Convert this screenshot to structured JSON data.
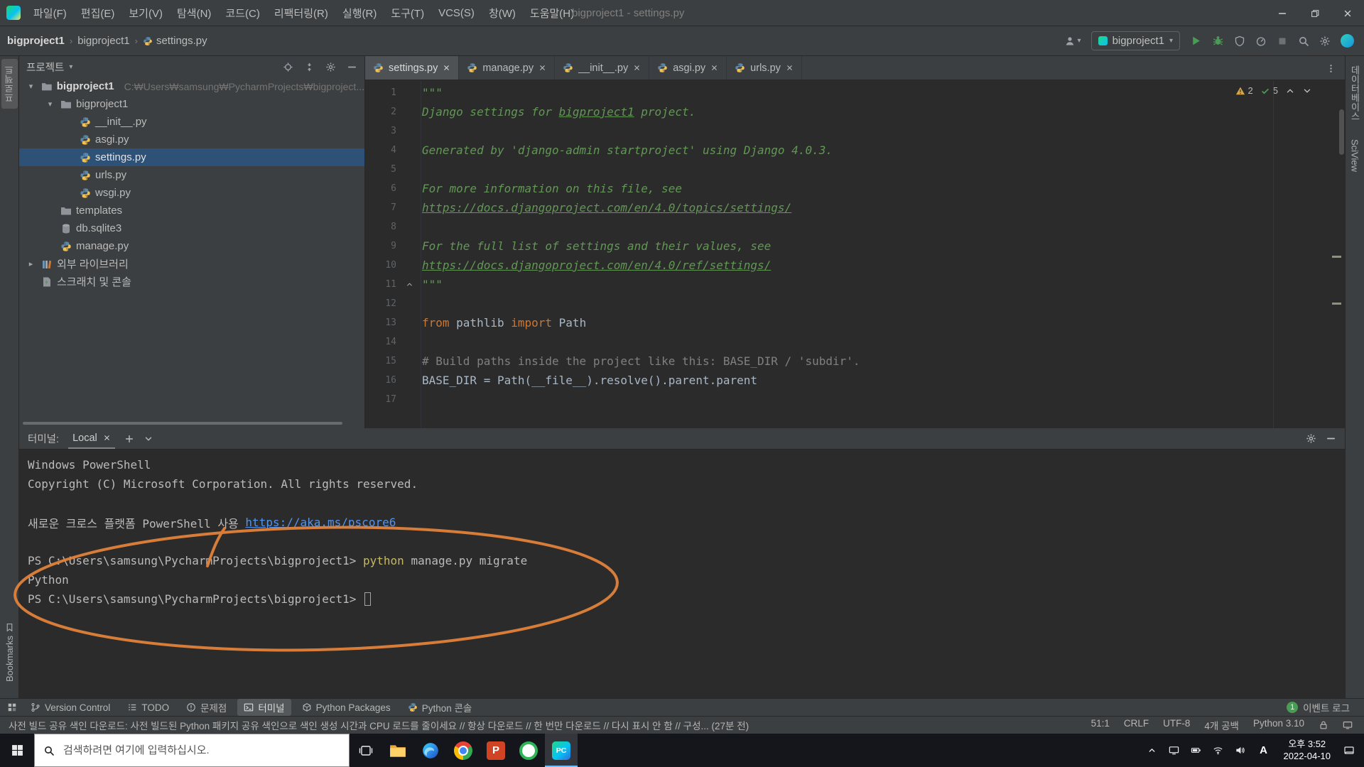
{
  "app": {
    "title": "bigproject1 - settings.py"
  },
  "titlebar": {
    "menus": [
      "파일(F)",
      "편집(E)",
      "보기(V)",
      "탐색(N)",
      "코드(C)",
      "리팩터링(R)",
      "실행(R)",
      "도구(T)",
      "VCS(S)",
      "창(W)",
      "도움말(H)"
    ]
  },
  "navbar": {
    "breadcrumbs": [
      {
        "label": "bigproject1"
      },
      {
        "label": "bigproject1"
      },
      {
        "label": "settings.py",
        "icon": "python"
      }
    ],
    "run_config": {
      "label": "bigproject1"
    }
  },
  "tool_strips": {
    "left_top": [
      {
        "label": "프로젝트",
        "active": true
      }
    ],
    "left_bottom": [
      {
        "label": "Bookmarks"
      }
    ],
    "right": [
      {
        "label": "데이터베이스"
      },
      {
        "label": "SciView"
      }
    ]
  },
  "project_panel": {
    "title": "프로젝트",
    "tree": [
      {
        "indent": 0,
        "chev": "down",
        "icon": "folder",
        "label": "bigproject1",
        "bold": true,
        "hint": "C:₩Users₩samsung₩PycharmProjects₩bigproject..."
      },
      {
        "indent": 1,
        "chev": "down",
        "icon": "folder",
        "label": "bigproject1"
      },
      {
        "indent": 2,
        "icon": "python",
        "label": "__init__.py"
      },
      {
        "indent": 2,
        "icon": "python",
        "label": "asgi.py"
      },
      {
        "indent": 2,
        "icon": "python",
        "label": "settings.py",
        "selected": true
      },
      {
        "indent": 2,
        "icon": "python",
        "label": "urls.py"
      },
      {
        "indent": 2,
        "icon": "python",
        "label": "wsgi.py"
      },
      {
        "indent": 1,
        "icon": "folder",
        "label": "templates"
      },
      {
        "indent": 1,
        "icon": "db",
        "label": "db.sqlite3"
      },
      {
        "indent": 1,
        "icon": "python",
        "label": "manage.py"
      },
      {
        "indent": 0,
        "chev": "right",
        "icon": "libs",
        "label": "외부 라이브러리"
      },
      {
        "indent": 0,
        "icon": "scratch",
        "label": "스크래치 및 콘솔"
      }
    ]
  },
  "editor": {
    "tabs": [
      {
        "label": "settings.py",
        "active": true
      },
      {
        "label": "manage.py"
      },
      {
        "label": "__init__.py"
      },
      {
        "label": "asgi.py"
      },
      {
        "label": "urls.py"
      }
    ],
    "inspections": {
      "warnings": "2",
      "ok": "5"
    },
    "lines": [
      {
        "n": "1",
        "segs": [
          {
            "t": "\"\"\"",
            "c": "doc"
          }
        ]
      },
      {
        "n": "2",
        "segs": [
          {
            "t": "Django settings for ",
            "c": "doc"
          },
          {
            "t": "bigproject1",
            "c": "doc-u"
          },
          {
            "t": " project.",
            "c": "doc"
          }
        ]
      },
      {
        "n": "3",
        "segs": []
      },
      {
        "n": "4",
        "segs": [
          {
            "t": "Generated by 'django-admin startproject' using Django 4.0.3.",
            "c": "doc"
          }
        ]
      },
      {
        "n": "5",
        "segs": []
      },
      {
        "n": "6",
        "segs": [
          {
            "t": "For more information on this file, see",
            "c": "doc"
          }
        ]
      },
      {
        "n": "7",
        "segs": [
          {
            "t": "https://docs.djangoproject.com/en/4.0/topics/settings/",
            "c": "doc-link"
          }
        ]
      },
      {
        "n": "8",
        "segs": []
      },
      {
        "n": "9",
        "segs": [
          {
            "t": "For the full list of settings and their values, see",
            "c": "doc"
          }
        ]
      },
      {
        "n": "10",
        "segs": [
          {
            "t": "https://docs.djangoproject.com/en/4.0/ref/settings/",
            "c": "doc-link"
          }
        ]
      },
      {
        "n": "11",
        "fold": true,
        "segs": [
          {
            "t": "\"\"\"",
            "c": "doc"
          }
        ]
      },
      {
        "n": "12",
        "segs": []
      },
      {
        "n": "13",
        "segs": [
          {
            "t": "from",
            "c": "kw"
          },
          {
            "t": " pathlib ",
            "c": "code"
          },
          {
            "t": "import",
            "c": "kw"
          },
          {
            "t": " Path",
            "c": "code"
          }
        ]
      },
      {
        "n": "14",
        "segs": []
      },
      {
        "n": "15",
        "segs": [
          {
            "t": "# Build paths inside the project like this: BASE_DIR / 'subdir'.",
            "c": "comment"
          }
        ]
      },
      {
        "n": "16",
        "segs": [
          {
            "t": "BASE_DIR = Path(__file__).resolve().parent.parent",
            "c": "code"
          }
        ]
      },
      {
        "n": "17",
        "segs": []
      }
    ]
  },
  "terminal_panel": {
    "label": "터미널:",
    "tab": "Local",
    "lines": [
      {
        "segs": [
          {
            "t": "Windows PowerShell",
            "c": "t"
          }
        ]
      },
      {
        "segs": [
          {
            "t": "Copyright (C) Microsoft Corporation. All rights reserved.",
            "c": "t"
          }
        ]
      },
      {
        "segs": []
      },
      {
        "segs": [
          {
            "t": "새로운 크로스 플랫폼 PowerShell 사용 ",
            "c": "t"
          },
          {
            "t": "https://aka.ms/pscore6",
            "c": "link"
          }
        ]
      },
      {
        "segs": []
      },
      {
        "segs": [
          {
            "t": "PS C:\\Users\\samsung\\PycharmProjects\\bigproject1> ",
            "c": "t"
          },
          {
            "t": "python",
            "c": "cmd"
          },
          {
            "t": " manage.py migrate",
            "c": "t"
          }
        ]
      },
      {
        "segs": [
          {
            "t": "Python",
            "c": "t"
          }
        ]
      },
      {
        "segs": [
          {
            "t": "PS C:\\Users\\samsung\\PycharmProjects\\bigproject1> ",
            "c": "t"
          }
        ],
        "cursor": true
      }
    ]
  },
  "bottom_bar": {
    "items": [
      {
        "icon": "branch",
        "label": "Version Control"
      },
      {
        "icon": "todo",
        "label": "TODO"
      },
      {
        "icon": "problem",
        "label": "문제점"
      },
      {
        "icon": "terminal",
        "label": "터미널",
        "active": true
      },
      {
        "icon": "package",
        "label": "Python Packages"
      },
      {
        "icon": "python",
        "label": "Python 콘솔"
      }
    ],
    "event_log": {
      "badge": "1",
      "label": "이벤트 로그"
    }
  },
  "status_bar": {
    "message": [
      {
        "t": "사전 빌드 공유 색인 다운로드: 사전 빌드된 Python 패키지 공유 색인으로 색인 생성 시간과 CPU 로드를 줄이세요 // "
      },
      {
        "t": "항상 다운로드",
        "link": true
      },
      {
        "t": " // "
      },
      {
        "t": "한 번만 다운로드",
        "link": true
      },
      {
        "t": " // "
      },
      {
        "t": "다시 표시 안 함",
        "link": true
      },
      {
        "t": " // "
      },
      {
        "t": "구성...",
        "link": true
      },
      {
        "t": " (27분 전)"
      }
    ],
    "right": [
      "51:1",
      "CRLF",
      "UTF-8",
      "4개 공백",
      "Python 3.10"
    ]
  },
  "taskbar": {
    "search_placeholder": "검색하려면 여기에 입력하십시오.",
    "apps": [
      {
        "name": "file-explorer"
      },
      {
        "name": "edge"
      },
      {
        "name": "chrome"
      },
      {
        "name": "powerpoint"
      },
      {
        "name": "green-app"
      },
      {
        "name": "pycharm",
        "active": true
      }
    ],
    "ime": "A",
    "time": "오후 3:52",
    "date": "2022-04-10"
  }
}
